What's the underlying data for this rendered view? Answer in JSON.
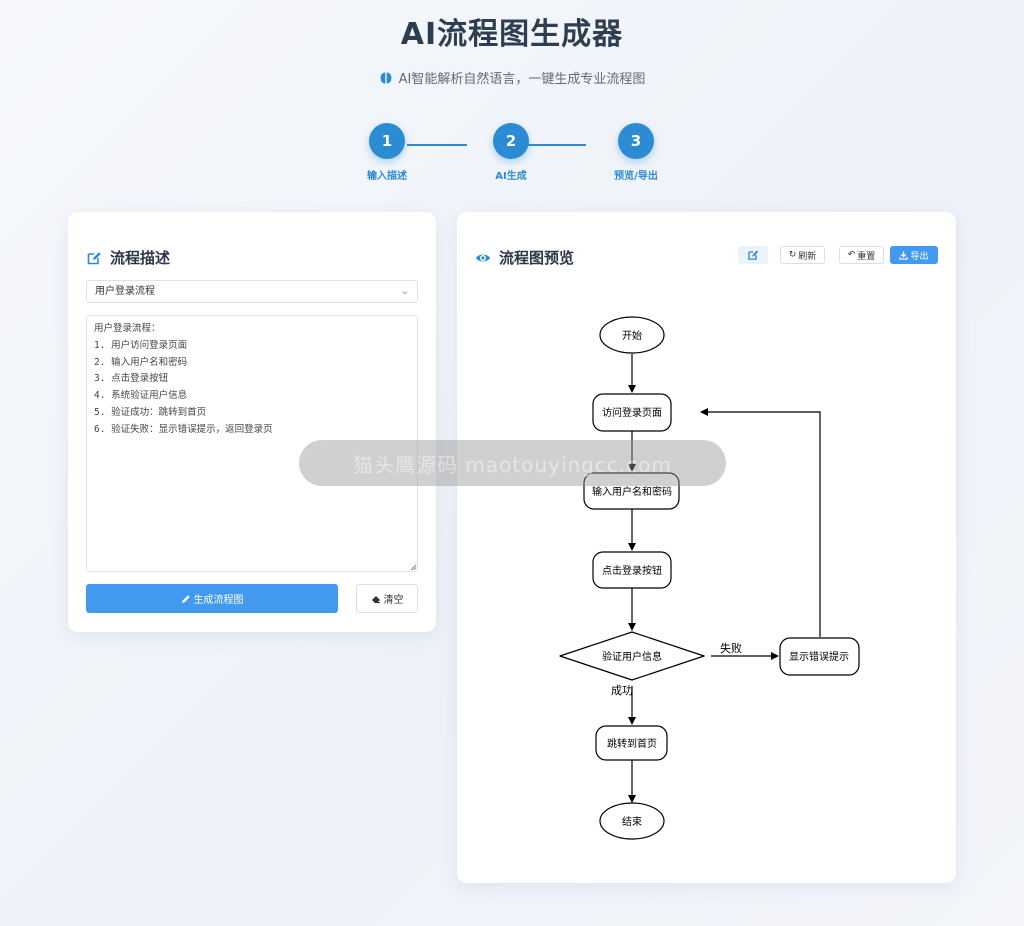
{
  "header": {
    "title": "AI流程图生成器",
    "subtitle": "AI智能解析自然语言，一键生成专业流程图"
  },
  "steps": [
    {
      "number": "1",
      "label": "输入描述"
    },
    {
      "number": "2",
      "label": "AI生成"
    },
    {
      "number": "3",
      "label": "预览/导出"
    }
  ],
  "left_panel": {
    "title": "流程描述",
    "select_value": "用户登录流程",
    "textarea_value": "用户登录流程：\n1. 用户访问登录页面\n2. 输入用户名和密码\n3. 点击登录按钮\n4. 系统验证用户信息\n5. 验证成功：跳转到首页\n6. 验证失败：显示错误提示，返回登录页",
    "generate_label": "生成流程图",
    "clear_label": "清空"
  },
  "right_panel": {
    "title": "流程图预览",
    "refresh_label": "刷新",
    "reset_label": "重置",
    "export_label": "导出"
  },
  "flowchart": {
    "nodes": {
      "start": "开始",
      "visit": "访问登录页面",
      "input": "输入用户名和密码",
      "click": "点击登录按钮",
      "verify": "验证用户信息",
      "error": "显示错误提示",
      "home": "跳转到首页",
      "end": "结束"
    },
    "edges": {
      "fail": "失败",
      "success": "成功"
    }
  },
  "watermark": "猫头鹰源码 maotouyingcc.com",
  "colors": {
    "accent": "#2b8bd3",
    "primary_button": "#4299ef"
  }
}
